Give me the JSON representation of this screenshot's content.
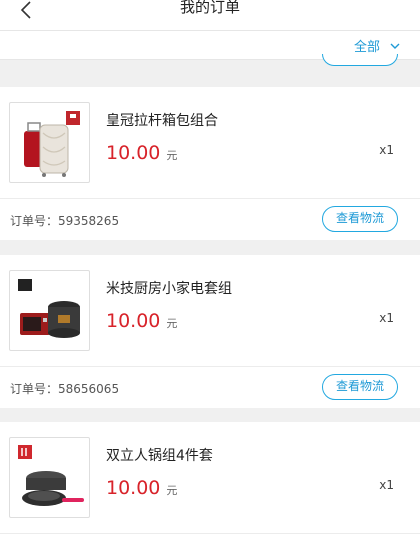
{
  "header": {
    "title": "我的订单"
  },
  "filter": {
    "label": "全部"
  },
  "orders": [
    {
      "name": "皇冠拉杆箱包组合",
      "price": "10.00",
      "unit": "元",
      "qty": "x1",
      "order_label": "订单号：59358265",
      "button": "查看物流",
      "thumb_icon": "luggage-set-icon"
    },
    {
      "name": "米技厨房小家电套组",
      "price": "10.00",
      "unit": "元",
      "qty": "x1",
      "order_label": "订单号：58656065",
      "button": "查看物流",
      "thumb_icon": "kitchen-appliance-icon"
    },
    {
      "name": "双立人锅组4件套",
      "price": "10.00",
      "unit": "元",
      "qty": "x1",
      "order_label": "",
      "button": "",
      "thumb_icon": "cookware-set-icon"
    }
  ],
  "colors": {
    "accent": "#1e9ad6",
    "price": "#d8232a"
  }
}
